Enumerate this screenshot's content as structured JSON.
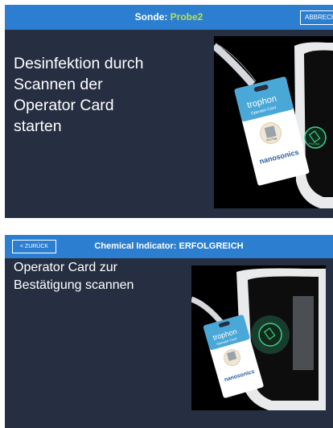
{
  "screen1": {
    "title_prefix": "Sonde: ",
    "title_value": "Probe2",
    "cancel_label": "ABBRECHEN",
    "instruction_line1": "Desinfektion durch",
    "instruction_line2": "Scannen der",
    "instruction_line3": "Operator Card",
    "instruction_line4": "starten"
  },
  "screen2": {
    "back_label": "< ZURÜCK",
    "title": "Chemical Indicator: ERFOLGREICH",
    "instruction_line1": "Operator Card zur",
    "instruction_line2": "Bestätigung scannen"
  },
  "card": {
    "brand": "trophon",
    "subtitle": "Operator Card",
    "tag": "ProTag",
    "maker_prefix": "nano",
    "maker_suffix": "sonics"
  },
  "colors": {
    "panel_background": "#262f42",
    "top_bar": "#2c7fd0",
    "probe_name": "#b8e04a",
    "card_blue": "#4aa8d8",
    "scan_glow": "#3fcf8e"
  }
}
